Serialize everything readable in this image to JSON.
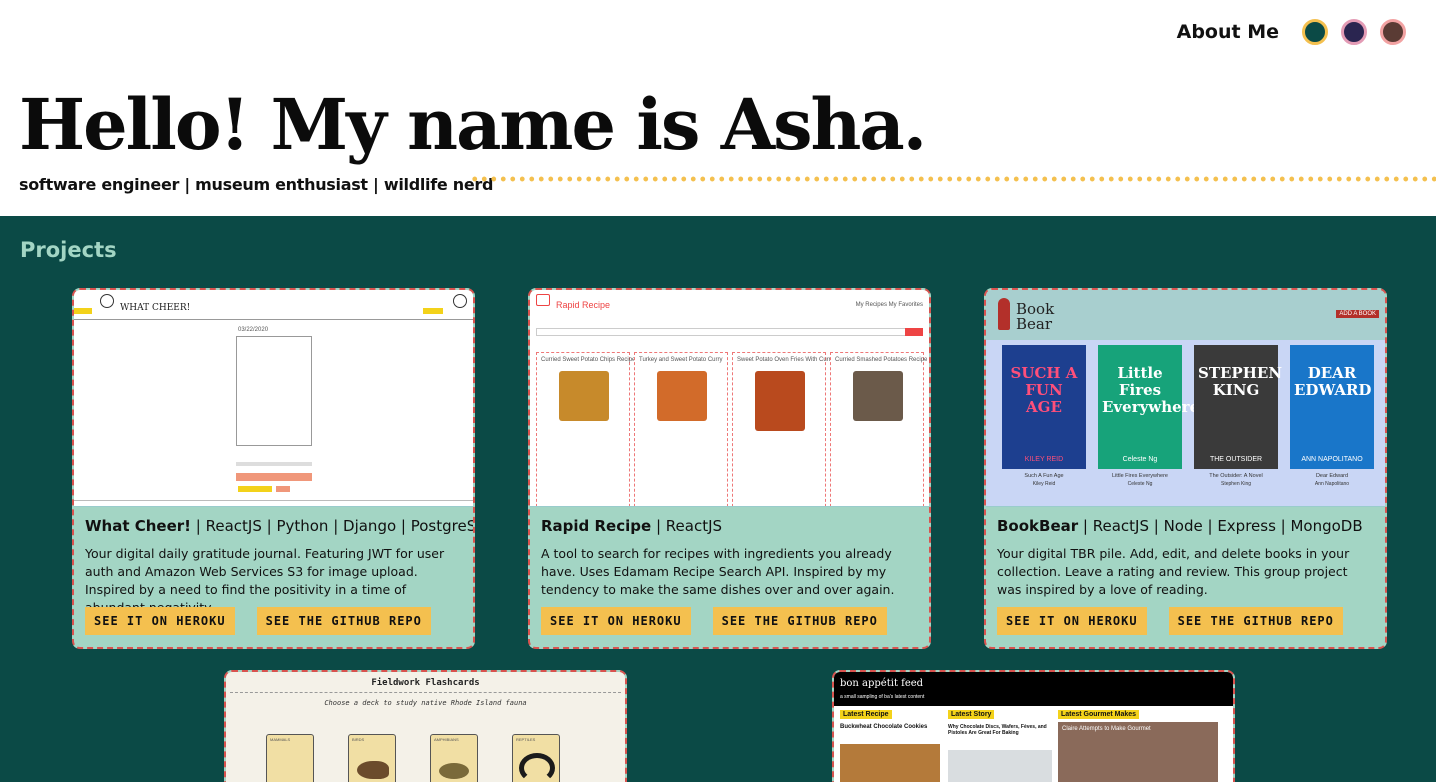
{
  "nav": {
    "about_label": "About Me",
    "theme_swatches": [
      {
        "fill": "#0b4a46",
        "ring": "#f4c04f"
      },
      {
        "fill": "#2a2550",
        "ring": "#e39bb5"
      },
      {
        "fill": "#5a3b34",
        "ring": "#f2a2a2"
      }
    ]
  },
  "hero": {
    "title": "Hello! My name is Asha.",
    "subtitle": "software engineer | museum enthusiast | wildlife nerd"
  },
  "projects": {
    "heading": "Projects",
    "cards": [
      {
        "name": "What Cheer!",
        "stack": " | ReactJS | Python | Django | PostgreSQL",
        "description": "Your digital daily gratitude journal. Featuring JWT for user auth and Amazon Web Services S3 for image upload. Inspired by a need to find the positivity in a time of abundant negativity.",
        "btn_primary": "SEE IT ON HEROKU",
        "btn_secondary": "SEE THE GITHUB REPO",
        "shot": {
          "app_title": "WHAT CHEER!",
          "date": "03/22/2020"
        }
      },
      {
        "name": "Rapid Recipe",
        "stack": " | ReactJS",
        "description": "A tool to search for recipes with ingredients you already have. Uses Edamam Recipe Search API. Inspired by my tendency to make the same dishes over and over again.",
        "btn_primary": "SEE IT ON HEROKU",
        "btn_secondary": "SEE THE GITHUB REPO",
        "shot": {
          "app_title": "Rapid Recipe",
          "nav": "My Recipes   My Favorites",
          "recipes": [
            "Curried Sweet Potato Chips Recipe",
            "Turkey and Sweet Potato Curry",
            "Sweet Potato Oven Fries With Curry-Honey Sauce",
            "Curried Smashed Potatoes Recipe"
          ]
        }
      },
      {
        "name": "BookBear",
        "stack": " | ReactJS | Node | Express | MongoDB",
        "description": "Your digital TBR pile. Add, edit, and delete books in your collection. Leave a rating and review. This group project was inspired by a love of reading.",
        "btn_primary": "SEE IT ON HEROKU",
        "btn_secondary": "SEE THE GITHUB REPO",
        "shot": {
          "logo_line1": "Book",
          "logo_line2": "Bear",
          "add_label": "ADD A BOOK",
          "books": [
            {
              "cover_title": "SUCH A FUN AGE",
              "author_cover": "KILEY REID",
              "caption": "Such A Fun Age",
              "author": "Kiley Reid",
              "color": "#1d3f8f",
              "accent": "#ff4f7a"
            },
            {
              "cover_title": "Little Fires Everywhere",
              "author_cover": "Celeste Ng",
              "caption": "Little Fires Everywhere",
              "author": "Celeste Ng",
              "color": "#17a37a",
              "accent": "#ffffff"
            },
            {
              "cover_title": "STEPHEN KING",
              "author_cover": "THE OUTSIDER",
              "caption": "The Outsider: A Novel",
              "author": "Stephen King",
              "color": "#3a3a3a",
              "accent": "#ffffff"
            },
            {
              "cover_title": "DEAR EDWARD",
              "author_cover": "ANN NAPOLITANO",
              "caption": "Dear Edward",
              "author": "Ann Napolitano",
              "color": "#1976c9",
              "accent": "#ffffff"
            }
          ]
        }
      },
      {
        "name": "Fieldwork Flashcards",
        "shot": {
          "app_title": "Fieldwork Flashcards",
          "tagline": "Choose a deck to study native Rhode Island fauna",
          "decks": [
            "MAMMALS",
            "BIRDS",
            "AMPHIBIANS",
            "REPTILES"
          ]
        }
      },
      {
        "name": "bon appétit feed",
        "shot": {
          "app_title": "bon appétit feed",
          "tagline": "a small sampling of ba's latest content",
          "columns": [
            {
              "label": "Latest Recipe",
              "headline": "Buckwheat Chocolate Cookies"
            },
            {
              "label": "Latest Story",
              "headline": "Why Chocolate Discs, Wafers, Fèves, and Pistoles Are Great For Baking"
            },
            {
              "label": "Latest Gourmet Makes",
              "headline": "Claire Attempts to Make Gourmet"
            }
          ]
        }
      }
    ]
  }
}
